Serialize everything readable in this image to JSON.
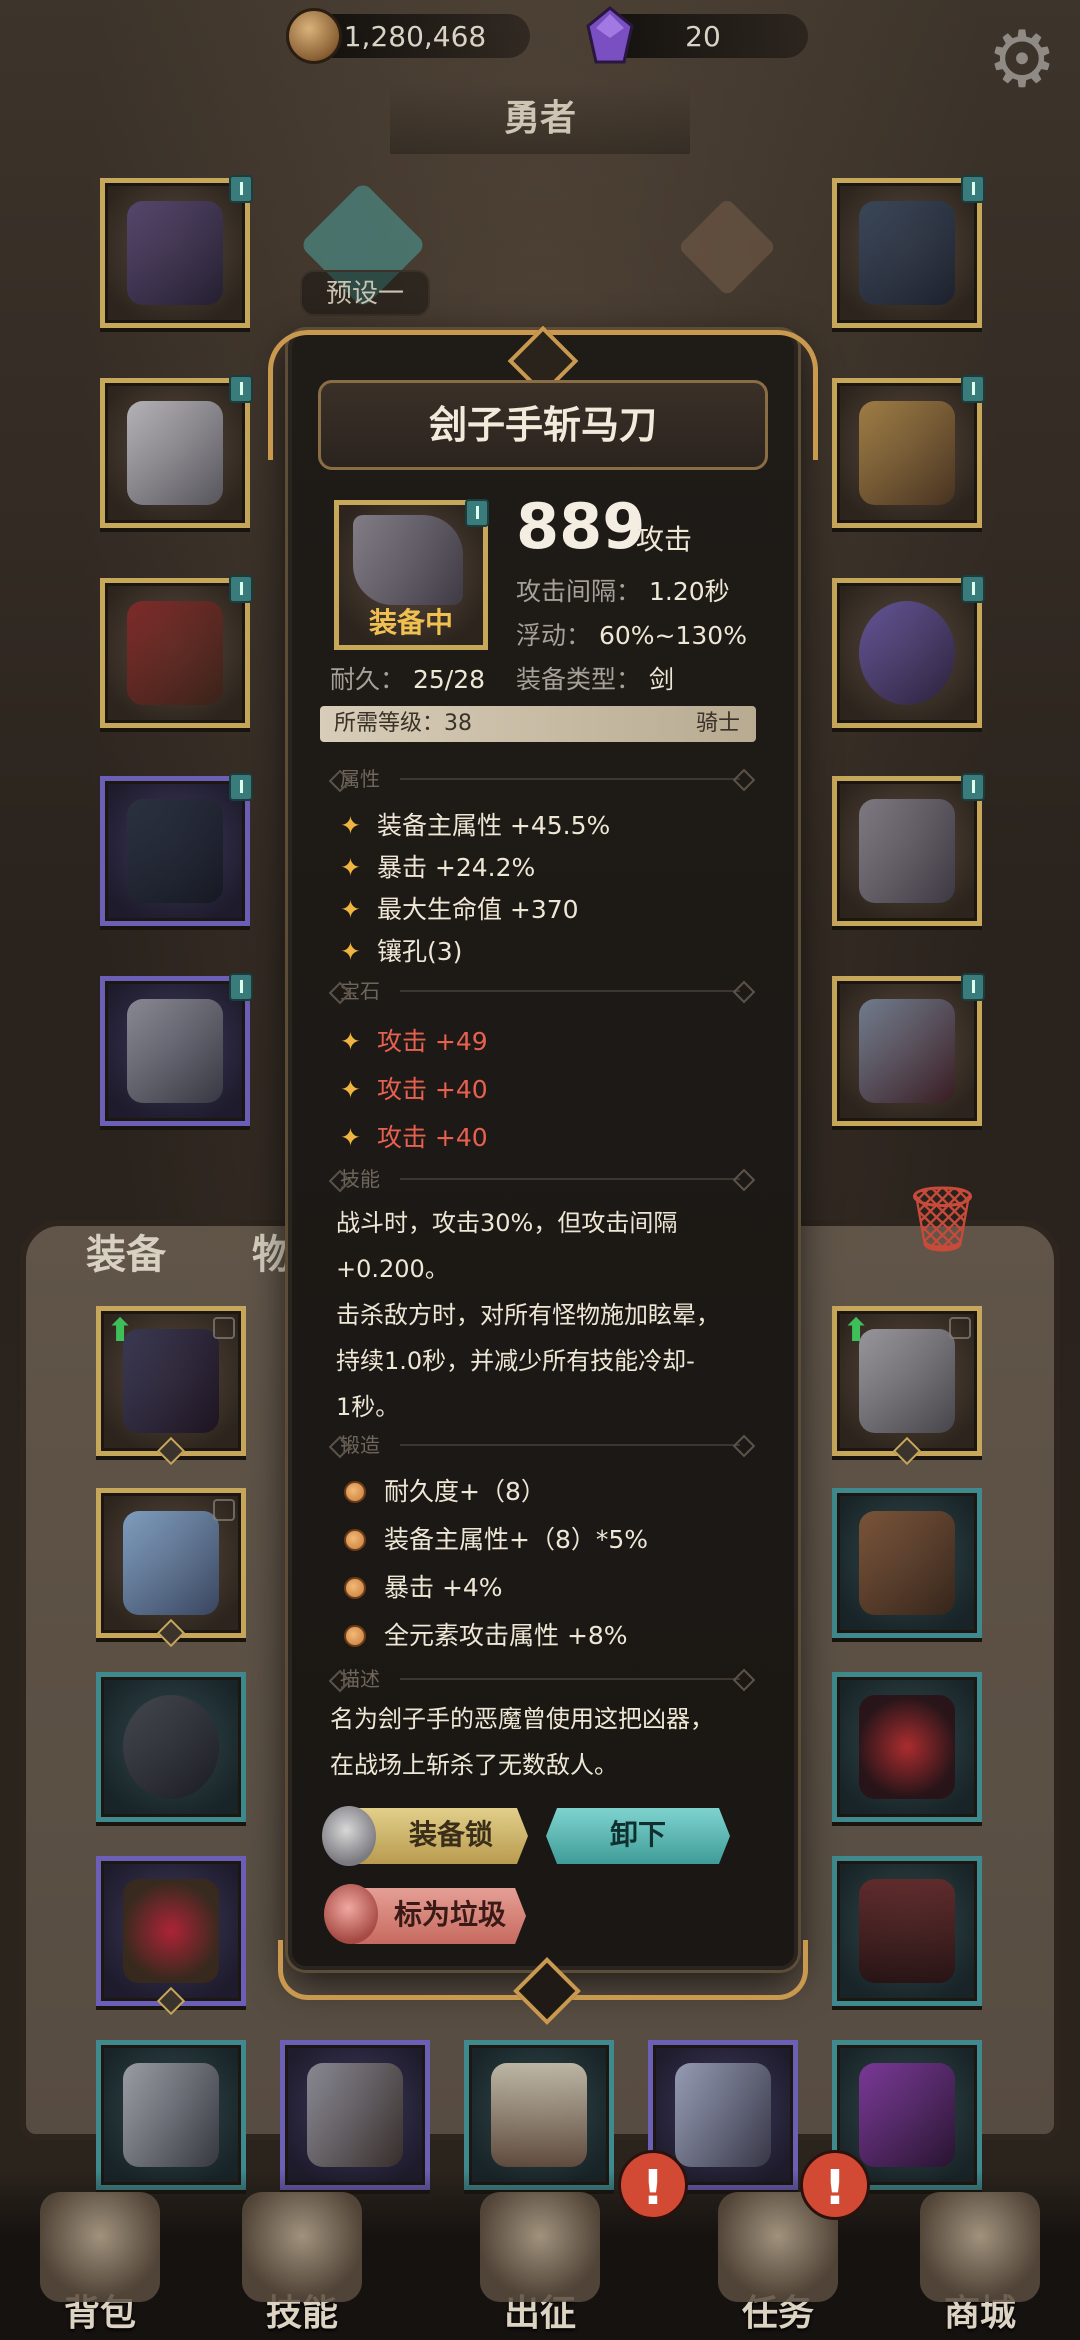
{
  "currencies": {
    "coins": "1,280,468",
    "gems": "20"
  },
  "hero": {
    "title": "勇者",
    "preset": "预设一"
  },
  "tabs": {
    "equipment": "装备",
    "items": "物品"
  },
  "tooltip": {
    "name": "刽子手斩马刀",
    "equipped_label": "装备中",
    "attack_value": "889",
    "attack_label": "攻击",
    "attack_interval_key": "攻击间隔：",
    "attack_interval_val": "1.20秒",
    "float_key": "浮动：",
    "float_val": "60%~130%",
    "durability_key": "耐久：",
    "durability_val": "25/28",
    "type_key": "装备类型：",
    "type_val": "剑",
    "required_level": "所需等级：38",
    "class": "骑士",
    "sections": {
      "attributes": "属性",
      "gems": "宝石",
      "skill": "技能",
      "forge": "锻造",
      "description": "描述"
    },
    "attributes": [
      "装备主属性 +45.5%",
      "暴击 +24.2%",
      "最大生命值 +370",
      "镶孔(3)"
    ],
    "gems": [
      "攻击 +49",
      "攻击 +40",
      "攻击 +40"
    ],
    "skill_lines": [
      "战斗时，攻击30%，但攻击间隔",
      "+0.200。",
      "击杀敌方时，对所有怪物施加眩晕，",
      "持续1.0秒，并减少所有技能冷却-",
      "1秒。"
    ],
    "forge": [
      "耐久度+（8）",
      "装备主属性+（8）*5%",
      "暴击 +4%",
      "全元素攻击属性 +8%"
    ],
    "description_lines": [
      "名为刽子手的恶魔曾使用这把凶器，",
      "在战场上斩杀了无数敌人。"
    ],
    "buttons": {
      "lock": "装备锁",
      "unequip": "卸下",
      "junk": "标为垃圾"
    }
  },
  "bottom_nav": [
    "背包",
    "技能",
    "出征",
    "任务",
    "商城"
  ],
  "colors": {
    "gold_frame": "#c7a75a",
    "purple_frame": "#6b5fb8",
    "teal_frame": "#3f8a8e",
    "gem_text": "#e86050",
    "accent_star": "#f0b440"
  },
  "icons": {
    "settings": "gear-icon",
    "coin": "coin-icon",
    "gem": "purple-gem-icon",
    "trash": "trash-icon"
  }
}
